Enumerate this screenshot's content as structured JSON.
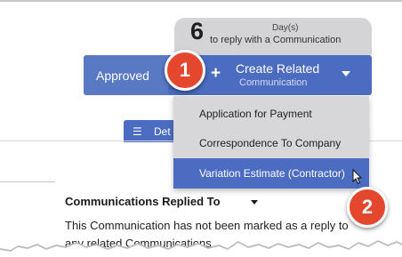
{
  "reply_counter": {
    "days_value": "6",
    "days_unit": "Day(s)",
    "days_text": "to reply with a Communication"
  },
  "actions": {
    "approved_label": "Approved",
    "create_related_label": "Create Related",
    "create_related_sublabel": "Communication",
    "plus_icon": "+",
    "create_caret_icon": "caret-down"
  },
  "step_badges": [
    "1",
    "2"
  ],
  "tab": {
    "details_label": "Det",
    "details_icon": "☰"
  },
  "create_menu": {
    "items": [
      "Application for Payment",
      "Correspondence To Company",
      "Variation Estimate (Contractor)"
    ],
    "selected_index": 2
  },
  "section": {
    "title": "Communications Replied To",
    "body": "This Communication has not been marked as a reply to any related Communications."
  },
  "colors": {
    "primary_blue": "#4b6cc0",
    "approved_blue": "#5979c5",
    "badge_red": "#e4472e",
    "panel_gray": "#d4d4d6"
  }
}
